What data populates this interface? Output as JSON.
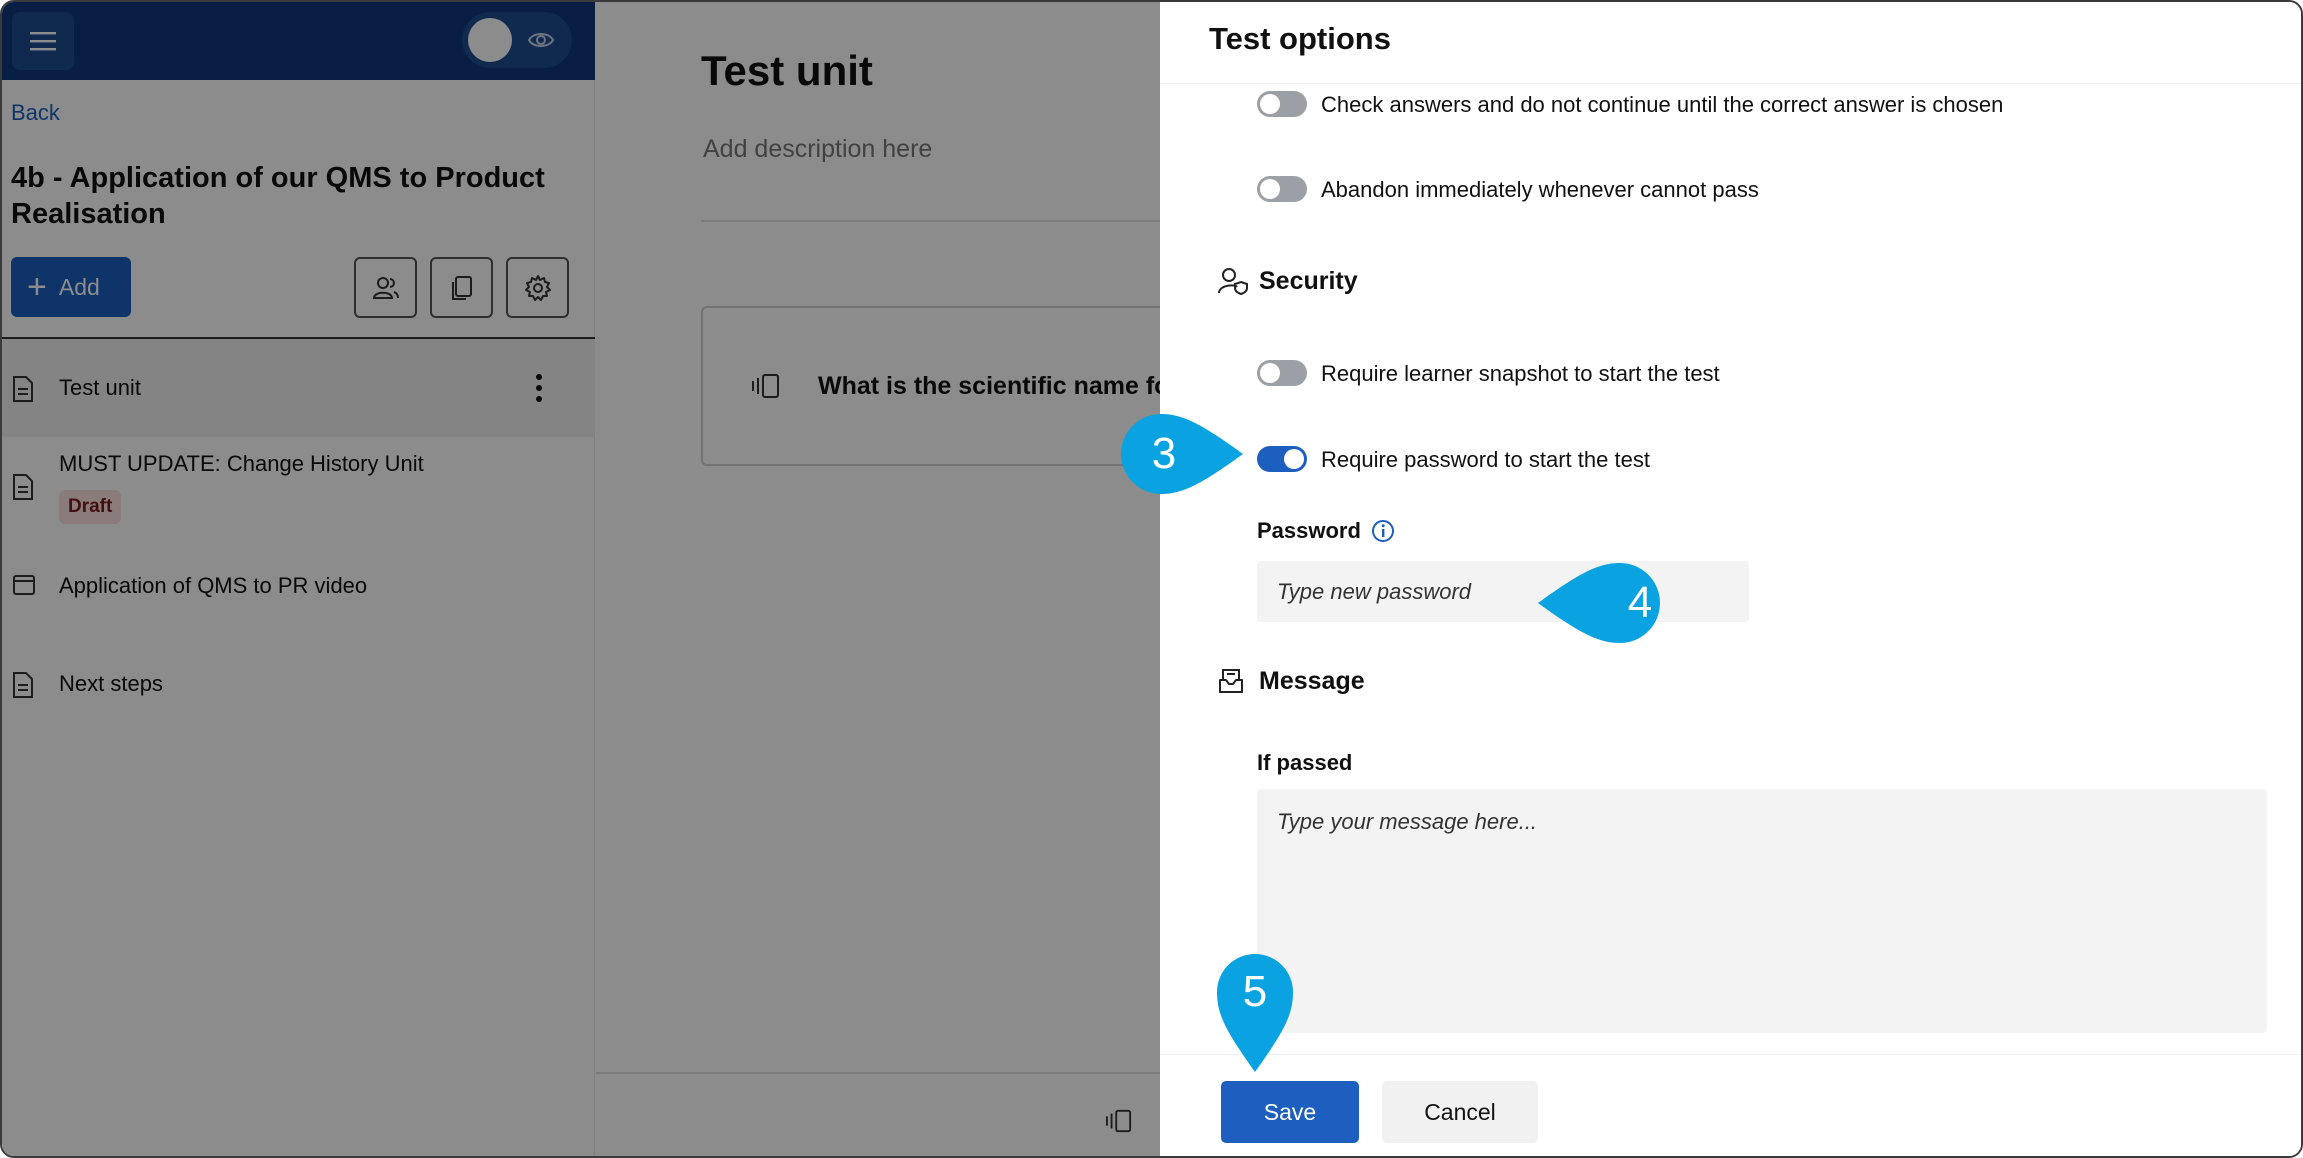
{
  "sidebar": {
    "back_label": "Back",
    "course_title": "4b - Application of our QMS to Product Realisation",
    "add_label": "Add",
    "items": [
      {
        "label": "Test unit",
        "icon": "document-icon"
      },
      {
        "label": "MUST UPDATE: Change History Unit",
        "icon": "document-icon",
        "badge": "Draft"
      },
      {
        "label": "Application of QMS to PR video",
        "icon": "video-icon"
      },
      {
        "label": "Next steps",
        "icon": "document-icon"
      }
    ]
  },
  "main": {
    "title": "Test unit",
    "description_placeholder": "Add description here",
    "question_text": "What is the scientific name fo"
  },
  "panel": {
    "title": "Test options",
    "options": [
      {
        "label": "Check answers and do not continue until the correct answer is chosen",
        "enabled": false
      },
      {
        "label": "Abandon immediately whenever cannot pass",
        "enabled": false
      }
    ],
    "security": {
      "heading": "Security",
      "options": [
        {
          "label": "Require learner snapshot to start the test",
          "enabled": false
        },
        {
          "label": "Require password to start the test",
          "enabled": true
        }
      ],
      "password_label": "Password",
      "password_placeholder": "Type new password"
    },
    "message": {
      "heading": "Message",
      "if_passed_label": "If passed",
      "message_placeholder": "Type your message here..."
    },
    "save_label": "Save",
    "cancel_label": "Cancel"
  },
  "callouts": [
    "3",
    "4",
    "5"
  ],
  "colors": {
    "accent": "#1d5fbf",
    "topbar": "#0f3a7a",
    "callout": "#0aa2e0",
    "draft_badge_bg": "#fde2e2"
  }
}
